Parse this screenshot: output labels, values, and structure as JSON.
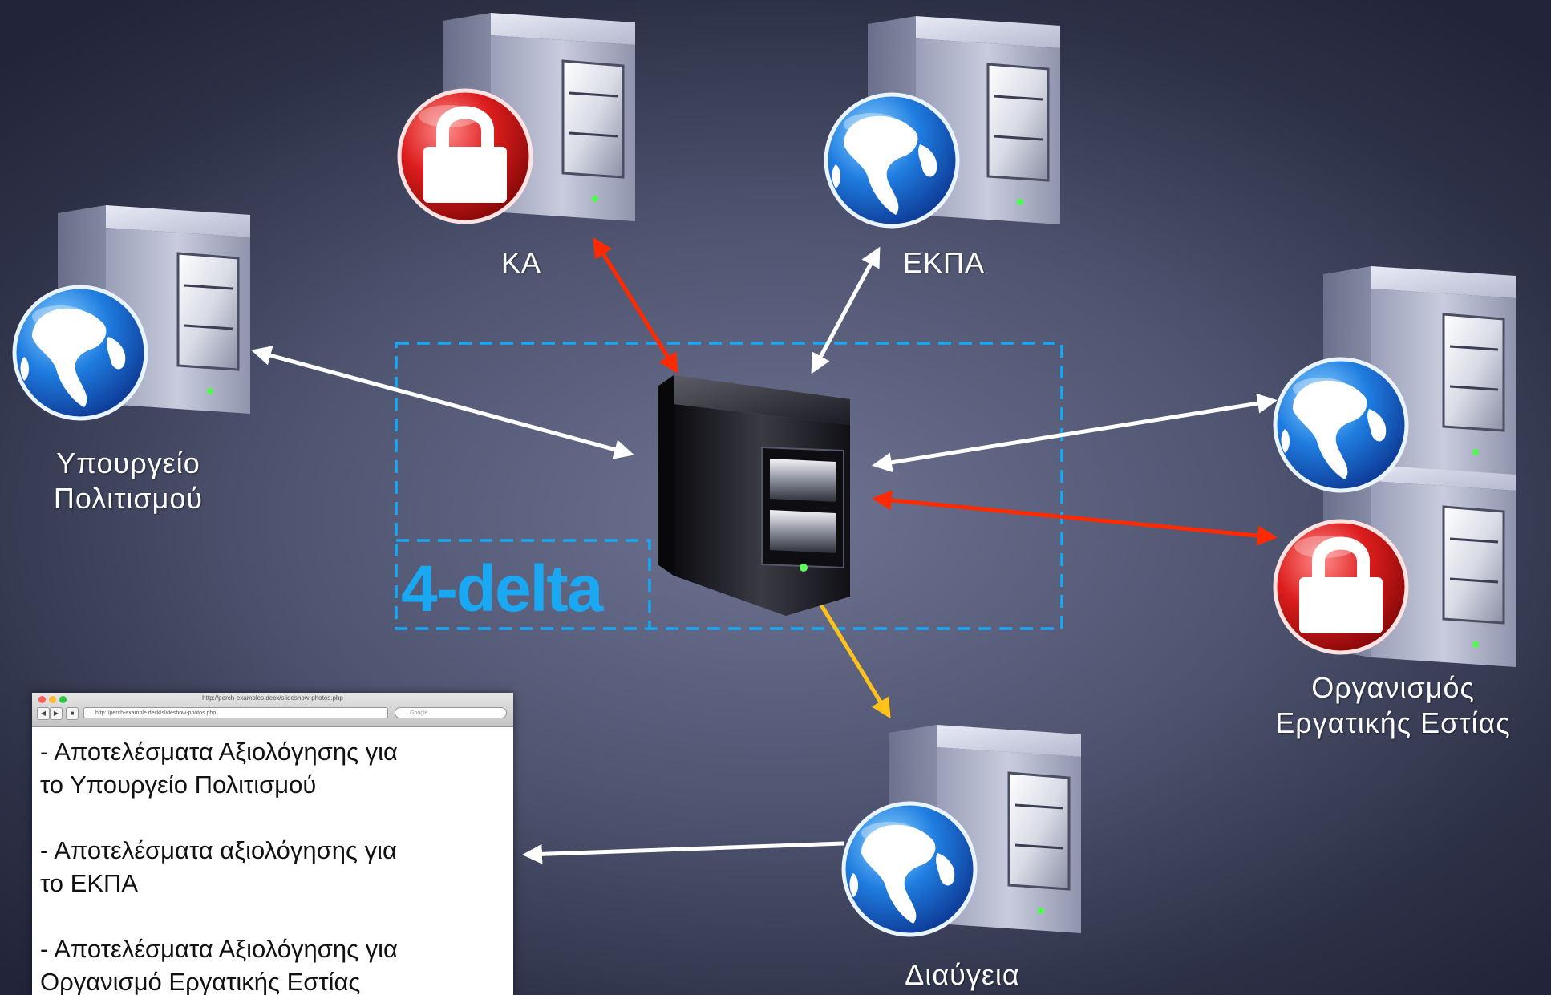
{
  "nodes": {
    "ka": {
      "label": "ΚΑ"
    },
    "ekpa": {
      "label": "ΕΚΠΑ"
    },
    "ministry": {
      "label_line1": "Υπουργείο",
      "label_line2": "Πολιτισμού"
    },
    "workers": {
      "label_line1": "Οργανισμός",
      "label_line2": "Εργατικής Εστίας"
    },
    "diavgeia": {
      "label": "Διαύγεια"
    },
    "center": {
      "title": "4-delta"
    }
  },
  "browser": {
    "title": "http://perch-examples.deck/slideshow-photos.php",
    "url": "http://perch-example.deck/slideshow-photos.php",
    "search_placeholder": "Google",
    "results": [
      {
        "line1": "- Αποτελέσματα Αξιολόγησης για",
        "line2": "το Υπουργείο Πολιτισμού"
      },
      {
        "line1": "- Αποτελέσματα αξιολόγησης για",
        "line2": "το ΕΚΠΑ"
      },
      {
        "line1": "- Αποτελέσματα Αξιολόγησης για",
        "line2": "Οργανισμό Εργατικής Εστίας"
      }
    ]
  },
  "connections": [
    {
      "from": "ka",
      "to": "center",
      "color": "#ff2a00",
      "direction": "both"
    },
    {
      "from": "ekpa",
      "to": "center",
      "color": "#ffffff",
      "direction": "both"
    },
    {
      "from": "ministry",
      "to": "center",
      "color": "#ffffff",
      "direction": "both"
    },
    {
      "from": "workers",
      "to": "center",
      "color": "#ffffff",
      "direction": "both"
    },
    {
      "from": "workers-secure",
      "to": "center",
      "color": "#ff2a00",
      "direction": "both"
    },
    {
      "from": "center",
      "to": "diavgeia",
      "color": "#ffc21a",
      "direction": "forward"
    },
    {
      "from": "diavgeia",
      "to": "browser",
      "color": "#ffffff",
      "direction": "forward"
    }
  ],
  "colors": {
    "accent": "#1aa8f2",
    "secure": "#ff2a00",
    "publish": "#ffc21a",
    "link": "#ffffff"
  },
  "icons": {
    "globe": "globe-icon",
    "lock": "lock-icon",
    "server": "server-icon"
  }
}
